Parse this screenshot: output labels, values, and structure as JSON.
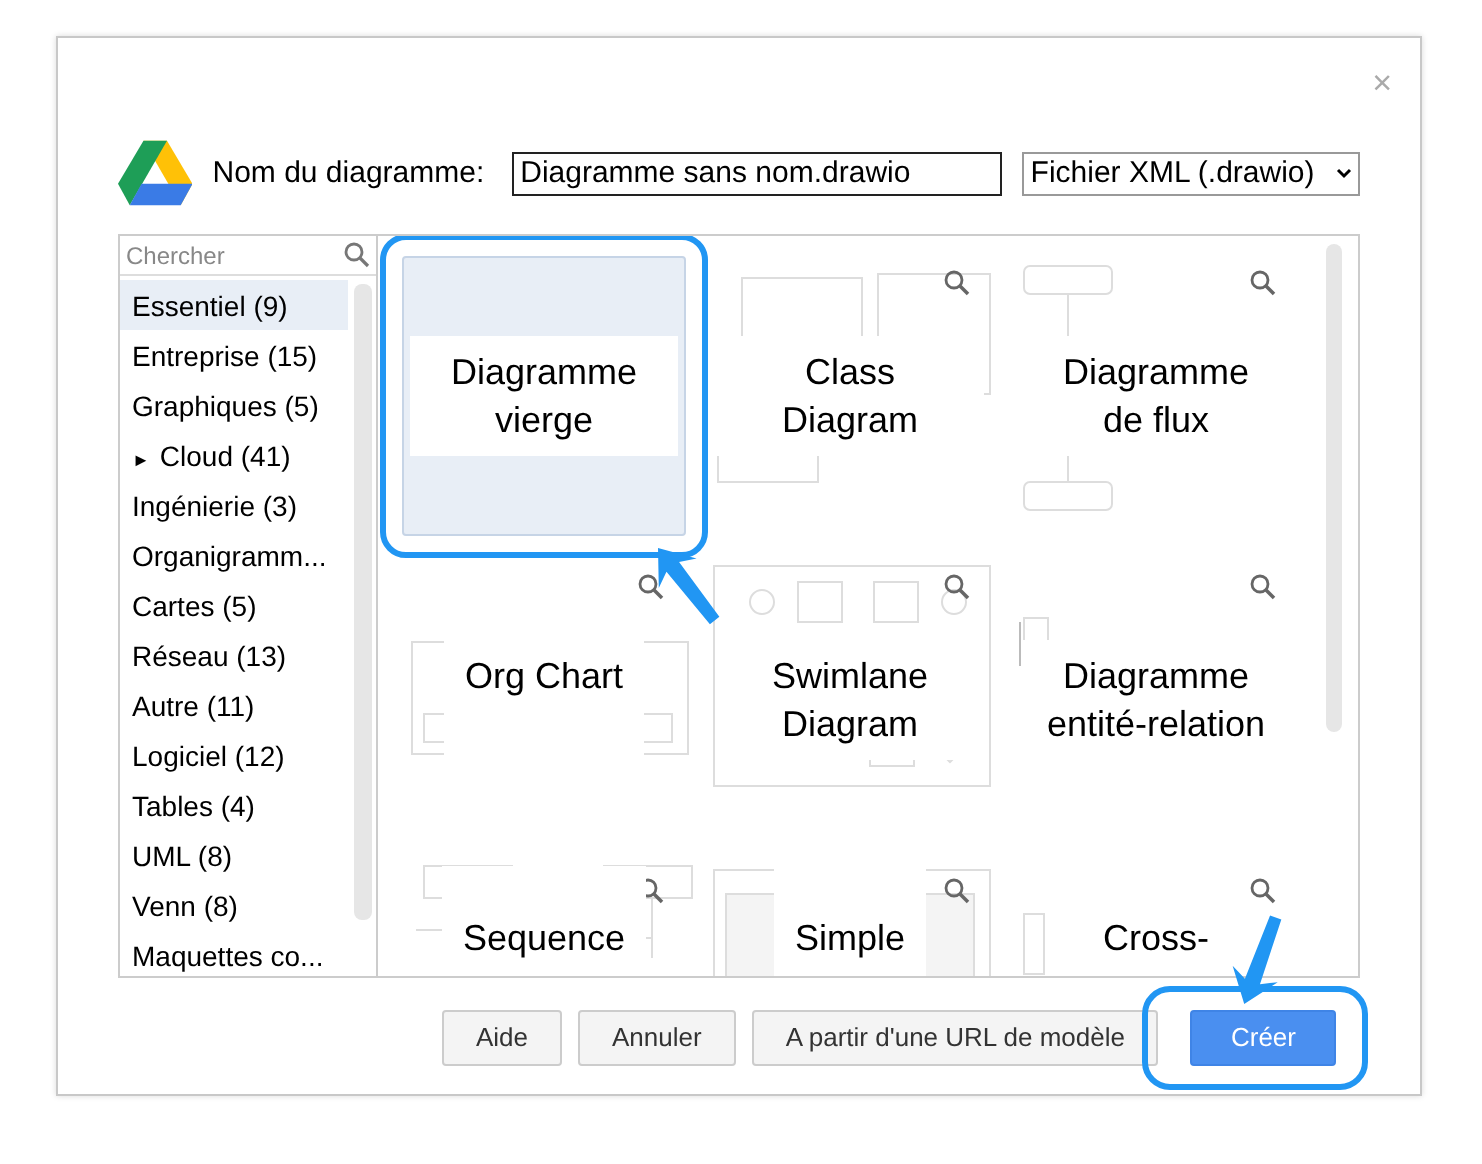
{
  "window": {
    "close": "×"
  },
  "header": {
    "name_label": "Nom du diagramme:",
    "name_value": "Diagramme sans nom.drawio",
    "format": "Fichier XML (.drawio)"
  },
  "search": {
    "placeholder": "Chercher"
  },
  "categories": [
    {
      "label": "Essentiel (9)",
      "selected": true
    },
    {
      "label": "Entreprise (15)",
      "selected": false
    },
    {
      "label": "Graphiques (5)",
      "selected": false
    },
    {
      "label": "Cloud (41)",
      "toggle": "►",
      "selected": false
    },
    {
      "label": "Ingénierie (3)",
      "selected": false
    },
    {
      "label": "Organigramm...",
      "selected": false
    },
    {
      "label": "Cartes (5)",
      "selected": false
    },
    {
      "label": "Réseau (13)",
      "selected": false
    },
    {
      "label": "Autre (11)",
      "selected": false
    },
    {
      "label": "Logiciel (12)",
      "selected": false
    },
    {
      "label": "Tables (4)",
      "selected": false
    },
    {
      "label": "UML (8)",
      "selected": false
    },
    {
      "label": "Venn (8)",
      "selected": false
    },
    {
      "label": "Maquettes co...",
      "selected": false
    }
  ],
  "templates": [
    {
      "label": "Diagramme vierge",
      "kind": "blank",
      "selected": true,
      "highlighted": true
    },
    {
      "label": "Class Diagram",
      "kind": "class",
      "selected": false,
      "highlighted": false
    },
    {
      "label": "Diagramme de flux",
      "kind": "flow",
      "selected": false,
      "highlighted": false
    },
    {
      "label": "Org Chart",
      "kind": "org",
      "selected": false,
      "highlighted": false
    },
    {
      "label": "Swimlane Diagram",
      "kind": "swimlane",
      "selected": false,
      "highlighted": false
    },
    {
      "label": "Diagramme entité-relation",
      "kind": "er",
      "selected": false,
      "highlighted": false
    },
    {
      "label": "Sequence",
      "kind": "sequence",
      "selected": false,
      "highlighted": false
    },
    {
      "label": "Simple",
      "kind": "table",
      "selected": false,
      "highlighted": false
    },
    {
      "label": "Cross-",
      "kind": "cross",
      "selected": false,
      "highlighted": false
    }
  ],
  "buttons": [
    {
      "label": "Aide",
      "kind": "default",
      "highlighted": false
    },
    {
      "label": "Annuler",
      "kind": "default",
      "highlighted": false
    },
    {
      "label": "A partir d'une URL de modèle",
      "kind": "default",
      "highlighted": false
    },
    {
      "label": "Créer",
      "kind": "primary",
      "highlighted": true
    }
  ]
}
